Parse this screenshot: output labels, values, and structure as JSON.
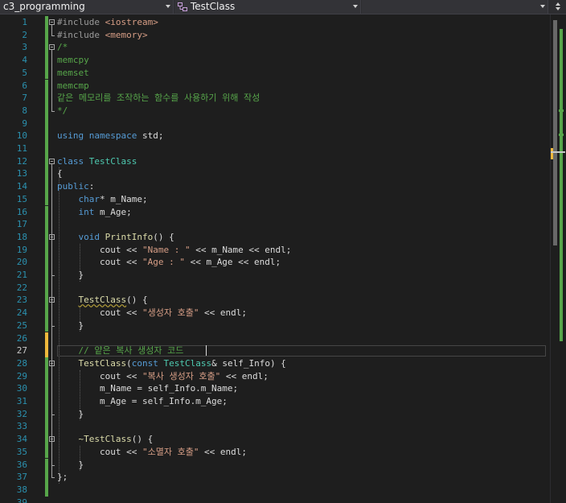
{
  "navbar": {
    "project": "c3_programming",
    "class_scope": "TestClass",
    "member_scope": ""
  },
  "editor": {
    "current_line": 27,
    "lines": [
      {
        "n": "1",
        "t": [
          [
            "pp",
            "#include "
          ],
          [
            "inc",
            "<iostream>"
          ]
        ]
      },
      {
        "n": "2",
        "t": [
          [
            "pp",
            "#include "
          ],
          [
            "inc",
            "<memory>"
          ]
        ]
      },
      {
        "n": "3",
        "t": [
          [
            "cm",
            "/*"
          ]
        ]
      },
      {
        "n": "4",
        "t": [
          [
            "cm",
            "memcpy"
          ]
        ]
      },
      {
        "n": "5",
        "t": [
          [
            "cm",
            "memset"
          ]
        ]
      },
      {
        "n": "6",
        "t": [
          [
            "cm",
            "memcmp"
          ]
        ]
      },
      {
        "n": "7",
        "t": [
          [
            "cm",
            "같은 메모리를 조작하는 함수를 사용하기 위해 작성"
          ]
        ]
      },
      {
        "n": "8",
        "t": [
          [
            "cm",
            "*/"
          ]
        ]
      },
      {
        "n": "9",
        "t": []
      },
      {
        "n": "10",
        "t": [
          [
            "kw",
            "using"
          ],
          [
            "id",
            " "
          ],
          [
            "kw",
            "namespace"
          ],
          [
            "id",
            " std;"
          ]
        ]
      },
      {
        "n": "11",
        "t": []
      },
      {
        "n": "12",
        "t": [
          [
            "kw",
            "class"
          ],
          [
            "id",
            " "
          ],
          [
            "ty",
            "TestClass"
          ]
        ]
      },
      {
        "n": "13",
        "t": [
          [
            "id",
            "{"
          ]
        ]
      },
      {
        "n": "14",
        "t": [
          [
            "kw",
            "public"
          ],
          [
            "id",
            ":"
          ]
        ]
      },
      {
        "n": "15",
        "t": [
          [
            "id",
            "    "
          ],
          [
            "kw",
            "char"
          ],
          [
            "id",
            "* m_Name;"
          ]
        ]
      },
      {
        "n": "16",
        "t": [
          [
            "id",
            "    "
          ],
          [
            "kw",
            "int"
          ],
          [
            "id",
            " m_Age;"
          ]
        ]
      },
      {
        "n": "17",
        "t": []
      },
      {
        "n": "18",
        "t": [
          [
            "id",
            "    "
          ],
          [
            "kw",
            "void"
          ],
          [
            "id",
            " "
          ],
          [
            "fn",
            "PrintInfo"
          ],
          [
            "id",
            "() {"
          ]
        ]
      },
      {
        "n": "19",
        "t": [
          [
            "id",
            "        cout << "
          ],
          [
            "str",
            "\"Name : \""
          ],
          [
            "id",
            " << m_Name << endl;"
          ]
        ]
      },
      {
        "n": "20",
        "t": [
          [
            "id",
            "        cout << "
          ],
          [
            "str",
            "\"Age : \""
          ],
          [
            "id",
            " << m_Age << endl;"
          ]
        ]
      },
      {
        "n": "21",
        "t": [
          [
            "id",
            "    }"
          ]
        ]
      },
      {
        "n": "22",
        "t": []
      },
      {
        "n": "23",
        "t": [
          [
            "id",
            "    "
          ],
          [
            "fn squig",
            "TestClass"
          ],
          [
            "id",
            "() {"
          ]
        ]
      },
      {
        "n": "24",
        "t": [
          [
            "id",
            "        cout << "
          ],
          [
            "str",
            "\"생성자 호출\""
          ],
          [
            "id",
            " << endl;"
          ]
        ]
      },
      {
        "n": "25",
        "t": [
          [
            "id",
            "    }"
          ]
        ]
      },
      {
        "n": "26",
        "t": []
      },
      {
        "n": "27",
        "t": [
          [
            "id",
            "    "
          ],
          [
            "cm",
            "// 얕은 복사 생성자 코드"
          ]
        ]
      },
      {
        "n": "28",
        "t": [
          [
            "id",
            "    "
          ],
          [
            "fn",
            "TestClass"
          ],
          [
            "id",
            "("
          ],
          [
            "kw",
            "const"
          ],
          [
            "id",
            " "
          ],
          [
            "ty",
            "TestClass"
          ],
          [
            "id",
            "& self_Info) {"
          ]
        ]
      },
      {
        "n": "29",
        "t": [
          [
            "id",
            "        cout << "
          ],
          [
            "str",
            "\"복사 생성자 호출\""
          ],
          [
            "id",
            " << endl;"
          ]
        ]
      },
      {
        "n": "30",
        "t": [
          [
            "id",
            "        m_Name = self_Info.m_Name;"
          ]
        ]
      },
      {
        "n": "31",
        "t": [
          [
            "id",
            "        m_Age = self_Info.m_Age;"
          ]
        ]
      },
      {
        "n": "32",
        "t": [
          [
            "id",
            "    }"
          ]
        ]
      },
      {
        "n": "33",
        "t": []
      },
      {
        "n": "34",
        "t": [
          [
            "id",
            "    "
          ],
          [
            "fn",
            "~TestClass"
          ],
          [
            "id",
            "() {"
          ]
        ]
      },
      {
        "n": "35",
        "t": [
          [
            "id",
            "        cout << "
          ],
          [
            "str",
            "\"소멸자 호출\""
          ],
          [
            "id",
            " << endl;"
          ]
        ]
      },
      {
        "n": "36",
        "t": [
          [
            "id",
            "    }"
          ]
        ]
      },
      {
        "n": "37",
        "t": [
          [
            "id",
            "};"
          ]
        ]
      },
      {
        "n": "38",
        "t": []
      },
      {
        "n": "39",
        "t": []
      }
    ]
  },
  "colors": {
    "keyword": "#569cd6",
    "type": "#4ec9b0",
    "function": "#dcdcaa",
    "string": "#d69d85",
    "comment": "#57a64a",
    "line_number": "#2b91af",
    "changed_saved": "#57a64a",
    "changed_unsaved": "#efb83c"
  }
}
